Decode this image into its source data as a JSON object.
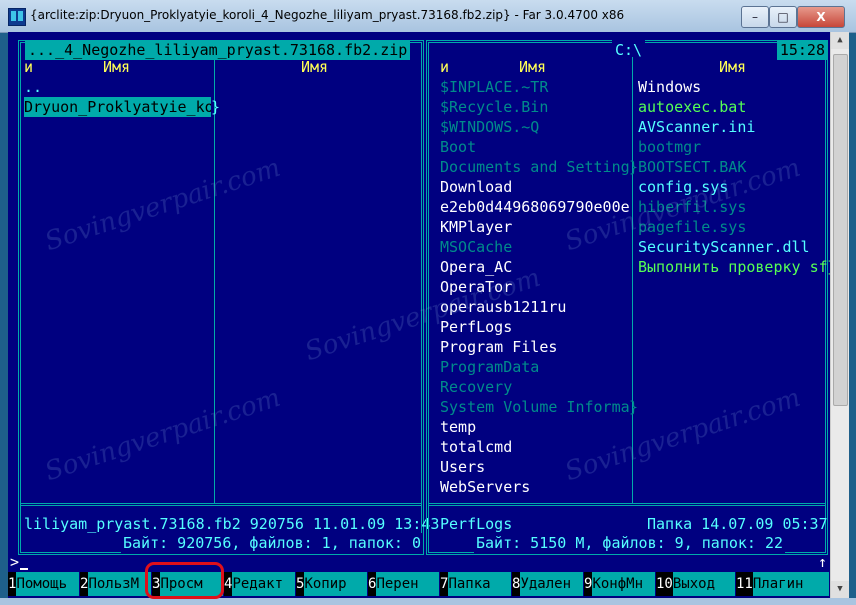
{
  "window": {
    "title": "{arclite:zip:Dryuon_Proklyatyie_koroli_4_Negozhe_liliyam_pryast.73168.fb2.zip} - Far 3.0.4700 x86",
    "buttons": {
      "minimize": "–",
      "maximize": "□",
      "close": "X"
    }
  },
  "left_panel": {
    "path": " ..._4_Negozhe_liliyam_pryast.73168.fb2.zip ",
    "col_n": "и",
    "col_name1": "Имя",
    "col_name2": "Имя",
    "items": [
      "..",
      "Dryuon_Proklyatyie_ko"
    ],
    "overflow_mark": "}",
    "status": "liliyam_pryast.73168.fb2 920756 11.01.09 13:43",
    "summary": " Байт: 920756, файлов: 1, папок: 0 "
  },
  "right_panel": {
    "path": " C:\\ ",
    "clock": "15:28",
    "col_n": "и",
    "col_name1": "Имя",
    "col_name2": "Имя",
    "col1": [
      {
        "name": "$INPLACE.~TR",
        "kind": "hidden"
      },
      {
        "name": "$Recycle.Bin",
        "kind": "hidden"
      },
      {
        "name": "$WINDOWS.~Q",
        "kind": "hidden"
      },
      {
        "name": "Boot",
        "kind": "hidden"
      },
      {
        "name": "Documents and Setting",
        "kind": "hidden",
        "overflow": "}"
      },
      {
        "name": "Download",
        "kind": "normal"
      },
      {
        "name": "e2eb0d44968069790e00e",
        "kind": "normal"
      },
      {
        "name": "KMPlayer",
        "kind": "normal"
      },
      {
        "name": "MSOCache",
        "kind": "hidden"
      },
      {
        "name": "Opera_AC",
        "kind": "normal"
      },
      {
        "name": "OperaTor",
        "kind": "normal"
      },
      {
        "name": "operausb1211ru",
        "kind": "normal"
      },
      {
        "name": "PerfLogs",
        "kind": "normal"
      },
      {
        "name": "Program Files",
        "kind": "normal"
      },
      {
        "name": "ProgramData",
        "kind": "hidden"
      },
      {
        "name": "Recovery",
        "kind": "hidden"
      },
      {
        "name": "System Volume Informa",
        "kind": "hidden",
        "overflow": "}"
      },
      {
        "name": "temp",
        "kind": "normal"
      },
      {
        "name": "totalcmd",
        "kind": "normal"
      },
      {
        "name": "Users",
        "kind": "normal"
      },
      {
        "name": "WebServers",
        "kind": "normal"
      }
    ],
    "col2": [
      {
        "name": "Windows",
        "kind": "normal"
      },
      {
        "name": "autoexec.bat",
        "kind": "exec"
      },
      {
        "name": "AVScanner.ini",
        "kind": "file"
      },
      {
        "name": "bootmgr",
        "kind": "hidden"
      },
      {
        "name": "BOOTSECT.BAK",
        "kind": "hidden"
      },
      {
        "name": "config.sys",
        "kind": "file"
      },
      {
        "name": "hiberfil.sys",
        "kind": "hidden"
      },
      {
        "name": "pagefile.sys",
        "kind": "hidden"
      },
      {
        "name": "SecurityScanner.dll",
        "kind": "file"
      },
      {
        "name": "Выполнить проверку sf",
        "kind": "exec",
        "overflow": "}"
      }
    ],
    "status_name": "PerfLogs",
    "status_info": "Папка 14.07.09 05:37",
    "summary": " Байт: 5150 М, файлов: 9, папок: 22 "
  },
  "command_line": {
    "prompt": ">",
    "scroll_mark": "↑"
  },
  "keybar": [
    {
      "num": "1",
      "label": "Помощь"
    },
    {
      "num": "2",
      "label": "ПользМ"
    },
    {
      "num": "3",
      "label": "Просм"
    },
    {
      "num": "4",
      "label": "Редакт"
    },
    {
      "num": "5",
      "label": "Копир"
    },
    {
      "num": "6",
      "label": "Перен"
    },
    {
      "num": "7",
      "label": "Папка"
    },
    {
      "num": "8",
      "label": "Удален"
    },
    {
      "num": "9",
      "label": "КонфМн"
    },
    {
      "num": "10",
      "label": "Выход"
    },
    {
      "num": "11",
      "label": "Плагин"
    }
  ],
  "watermark": "Sovingverpair.com",
  "colors": {
    "background": "#000080",
    "border": "#00aaaa",
    "selection": "#00aaaa",
    "highlight_ring": "#e0101a"
  }
}
